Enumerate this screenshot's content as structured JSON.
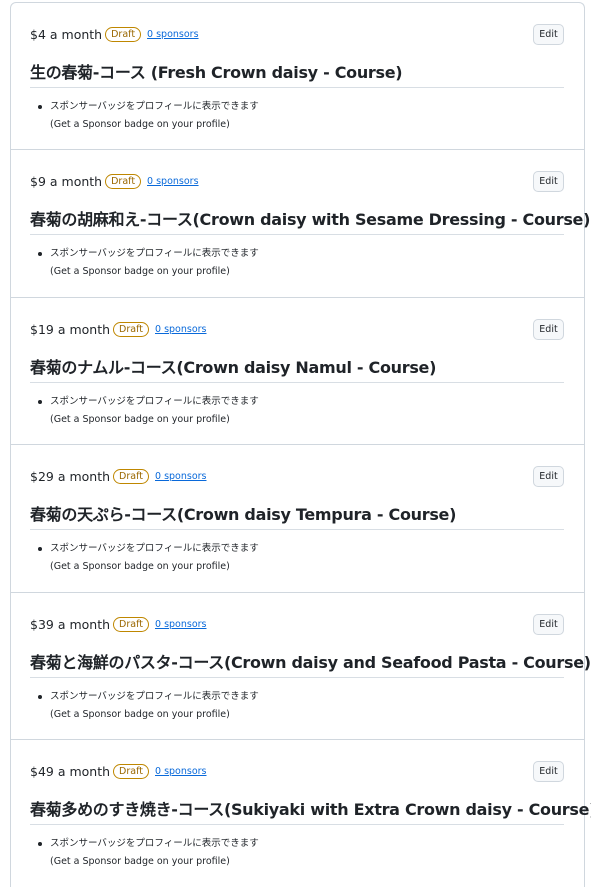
{
  "tiers": [
    {
      "price": "$4 a month",
      "badge": "Draft",
      "sponsors": "0 sponsors",
      "edit_label": "Edit",
      "title": "生の春菊-コース (Fresh Crown daisy - Course)",
      "benefit_ja": "スポンサーバッジをプロフィールに表示できます",
      "benefit_en": "(Get a Sponsor badge on your profile)"
    },
    {
      "price": "$9 a month",
      "badge": "Draft",
      "sponsors": "0 sponsors",
      "edit_label": "Edit",
      "title": "春菊の胡麻和え-コース(Crown daisy with Sesame Dressing - Course)",
      "benefit_ja": "スポンサーバッジをプロフィールに表示できます",
      "benefit_en": "(Get a Sponsor badge on your profile)"
    },
    {
      "price": "$19 a month",
      "badge": "Draft",
      "sponsors": "0 sponsors",
      "edit_label": "Edit",
      "title": "春菊のナムル-コース(Crown daisy Namul - Course)",
      "benefit_ja": "スポンサーバッジをプロフィールに表示できます",
      "benefit_en": "(Get a Sponsor badge on your profile)"
    },
    {
      "price": "$29 a month",
      "badge": "Draft",
      "sponsors": "0 sponsors",
      "edit_label": "Edit",
      "title": "春菊の天ぷら-コース(Crown daisy Tempura - Course)",
      "benefit_ja": "スポンサーバッジをプロフィールに表示できます",
      "benefit_en": "(Get a Sponsor badge on your profile)"
    },
    {
      "price": "$39 a month",
      "badge": "Draft",
      "sponsors": "0 sponsors",
      "edit_label": "Edit",
      "title": "春菊と海鮮のパスタ-コース(Crown daisy and Seafood Pasta - Course)",
      "benefit_ja": "スポンサーバッジをプロフィールに表示できます",
      "benefit_en": "(Get a Sponsor badge on your profile)"
    },
    {
      "price": "$49 a month",
      "badge": "Draft",
      "sponsors": "0 sponsors",
      "edit_label": "Edit",
      "title": "春菊多めのすき焼き-コース(Sukiyaki with Extra Crown daisy - Course)",
      "benefit_ja": "スポンサーバッジをプロフィールに表示できます",
      "benefit_en": "(Get a Sponsor badge on your profile)"
    }
  ],
  "colors": {
    "draft_badge": "#9a6700",
    "link": "#0969da",
    "border": "#d0d7de",
    "text": "#1f2328"
  }
}
